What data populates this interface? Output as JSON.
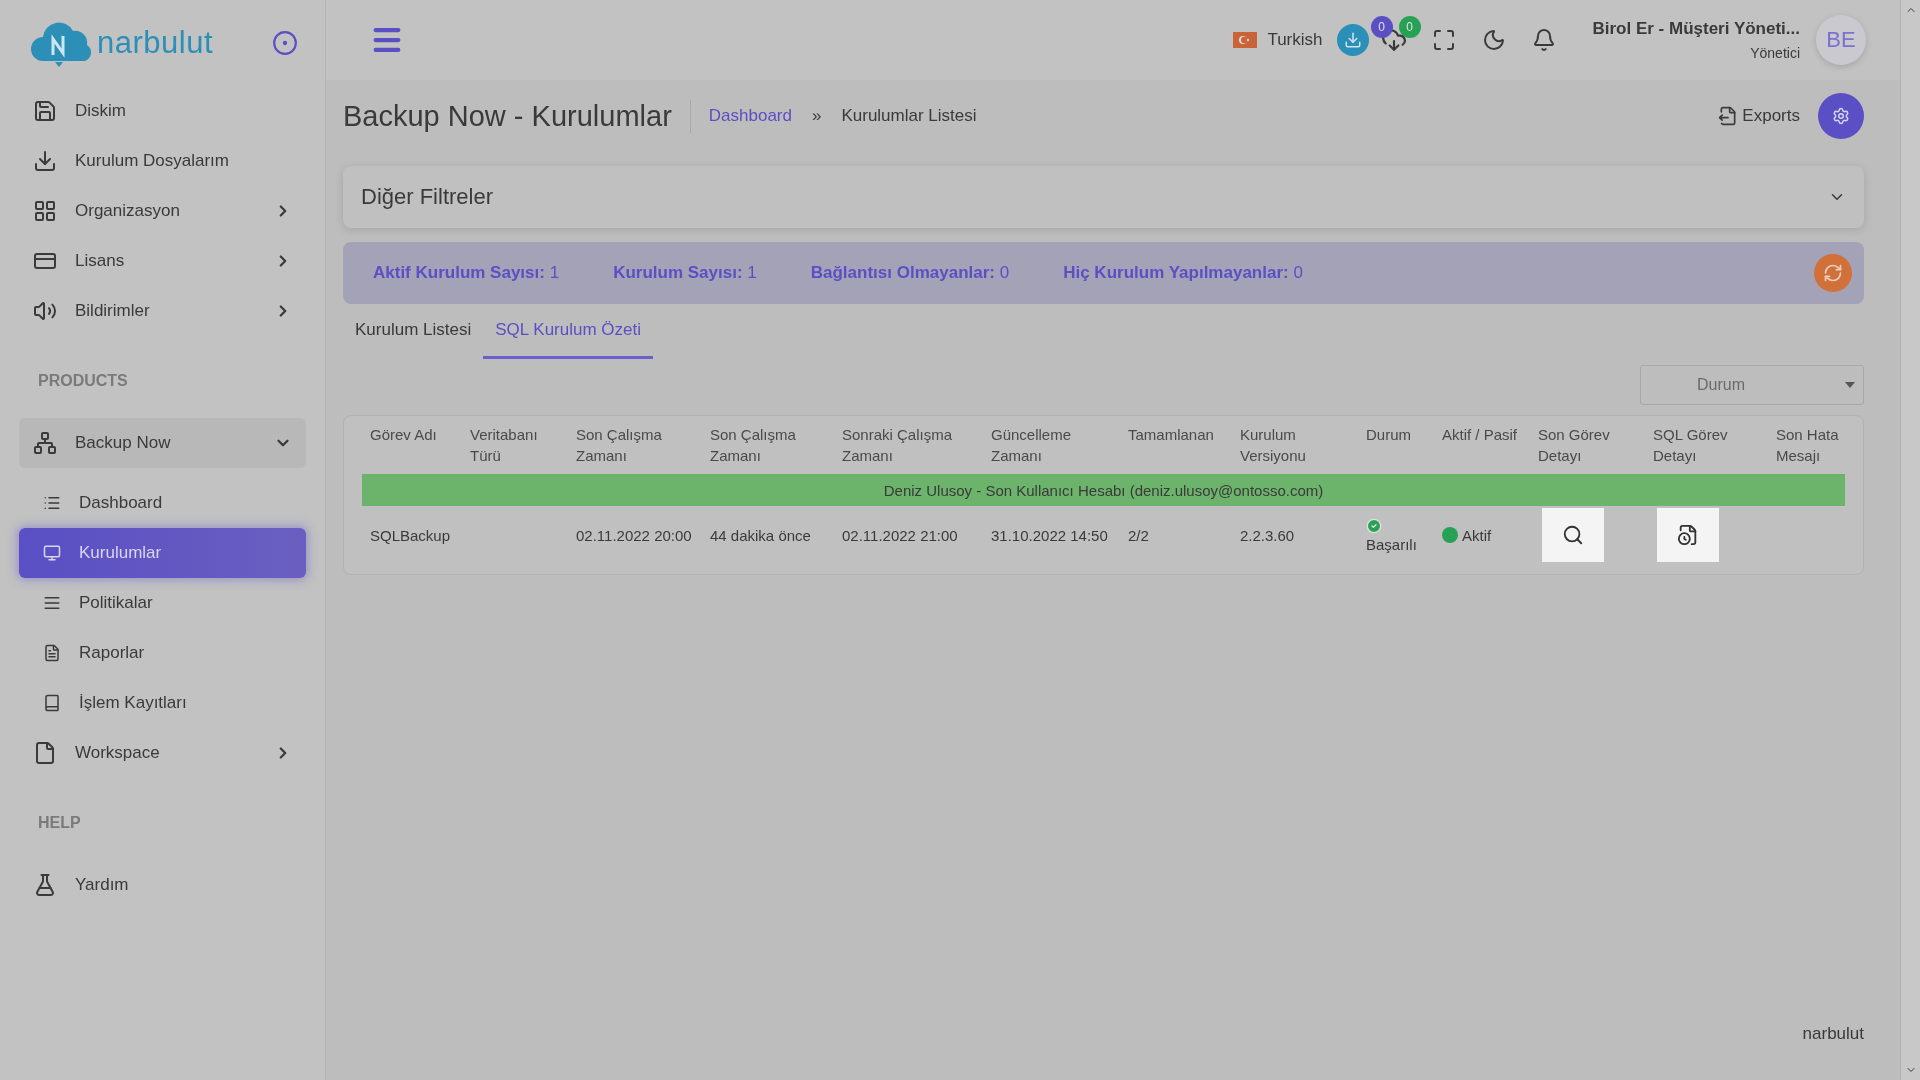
{
  "brand": {
    "name": "narbulut"
  },
  "sidebar": {
    "sections": [
      {
        "items": [
          {
            "label": "Diskim",
            "selected": false
          },
          {
            "label": "Kurulum Dosyalarım",
            "selected": false
          },
          {
            "label": "Organizasyon",
            "expanded": false,
            "selected": false
          },
          {
            "label": "Lisans",
            "expanded": false,
            "selected": false
          },
          {
            "label": "Bildirimler",
            "expanded": false,
            "selected": false
          }
        ]
      },
      {
        "heading": "PRODUCTS",
        "items": [
          {
            "label": "Backup Now",
            "expanded": true,
            "selected": false,
            "children": [
              {
                "label": "Dashboard",
                "selected": false
              },
              {
                "label": "Kurulumlar",
                "selected": true
              },
              {
                "label": "Politikalar",
                "selected": false
              },
              {
                "label": "Raporlar",
                "selected": false
              },
              {
                "label": "İşlem Kayıtları",
                "selected": false
              }
            ]
          },
          {
            "label": "Workspace",
            "expanded": false,
            "selected": false
          }
        ]
      },
      {
        "heading": "HELP",
        "items": [
          {
            "label": "Yardım",
            "selected": false
          }
        ]
      }
    ]
  },
  "topbar": {
    "language": "Turkish",
    "badges": [
      {
        "count": "0",
        "color": "#5b4fc4"
      },
      {
        "count": "0",
        "color": "#27a255"
      }
    ],
    "user_name": "Birol Er - Müşteri Yöneti...",
    "user_role": "Yönetici",
    "avatar_initials": "BE"
  },
  "page": {
    "title": "Backup Now - Kurulumlar",
    "breadcrumb": [
      "Dashboard",
      "Kurulumlar Listesi"
    ],
    "breadcrumb_separator": "»",
    "exports_label": "Exports"
  },
  "filters": {
    "title": "Diğer Filtreler",
    "expanded": false
  },
  "stats": [
    {
      "label": "Aktif Kurulum Sayısı:",
      "value": "1"
    },
    {
      "label": "Kurulum Sayısı:",
      "value": "1"
    },
    {
      "label": "Bağlantısı Olmayanlar:",
      "value": "0"
    },
    {
      "label": "Hiç Kurulum Yapılmayanlar:",
      "value": "0"
    }
  ],
  "tabs": [
    {
      "label": "Kurulum Listesi",
      "selected": false
    },
    {
      "label": "SQL Kurulum Özeti",
      "selected": true
    }
  ],
  "status_filter": {
    "placeholder": "Durum"
  },
  "table": {
    "columns": [
      "Görev Adı",
      "Veritabanı Türü",
      "Son Çalışma Zamanı",
      "Son Çalışma Zamanı",
      "Sonraki Çalışma Zamanı",
      "Güncelleme Zamanı",
      "Tamamlanan",
      "Kurulum Versiyonu",
      "Durum",
      "Aktif / Pasif",
      "Son Görev Detayı",
      "SQL Görev Detayı",
      "Son Hata Mesajı"
    ],
    "groups": [
      {
        "title": "Deniz Ulusoy - Son Kullanıcı Hesabı (deniz.ulusoy@ontosso.com)",
        "rows": [
          {
            "cells": [
              {
                "kind": "text",
                "text": "SQLBackup"
              },
              {
                "kind": "empty"
              },
              {
                "kind": "text",
                "text": "02.11.2022 20:00"
              },
              {
                "kind": "text",
                "text": "44 dakika önce"
              },
              {
                "kind": "text",
                "text": "02.11.2022 21:00"
              },
              {
                "kind": "text",
                "text": "31.10.2022 14:50"
              },
              {
                "kind": "text",
                "text": "2/2"
              },
              {
                "kind": "text",
                "text": "2.2.3.60"
              },
              {
                "kind": "status",
                "text": "Başarılı",
                "ok": true
              },
              {
                "kind": "active",
                "text": "Aktif",
                "on": true
              },
              {
                "kind": "detail_button"
              },
              {
                "kind": "sql_button"
              },
              {
                "kind": "empty"
              }
            ]
          }
        ]
      }
    ]
  },
  "footer": {
    "text": "narbulut"
  }
}
